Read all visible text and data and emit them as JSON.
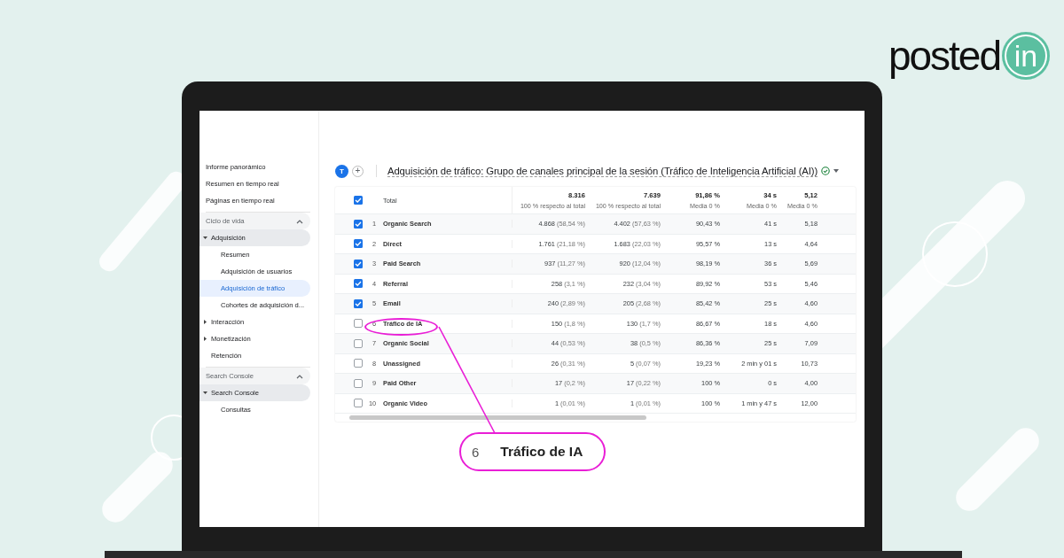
{
  "brand": {
    "logo_text": "posted",
    "logo_badge": "in"
  },
  "sidebar": {
    "top_items": [
      {
        "label": "Informe panorámico"
      },
      {
        "label": "Resumen en tiempo real"
      },
      {
        "label": "Páginas en tiempo real"
      }
    ],
    "sections": [
      {
        "title": "Ciclo de vida",
        "expanded": true,
        "items": [
          {
            "label": "Adquisición",
            "kind": "group",
            "expanded": true,
            "children": [
              {
                "label": "Resumen",
                "selected": false
              },
              {
                "label": "Adquisición de usuarios",
                "selected": false
              },
              {
                "label": "Adquisición de tráfico",
                "selected": true
              },
              {
                "label": "Cohortes de adquisición d...",
                "selected": false
              }
            ]
          },
          {
            "label": "Interacción",
            "kind": "group",
            "expanded": false
          },
          {
            "label": "Monetización",
            "kind": "group",
            "expanded": false
          },
          {
            "label": "Retención",
            "kind": "page"
          }
        ]
      },
      {
        "title": "Search Console",
        "expanded": true,
        "items": [
          {
            "label": "Search Console",
            "kind": "group",
            "expanded": true,
            "children": [
              {
                "label": "Consultas",
                "selected": false
              }
            ]
          }
        ]
      }
    ]
  },
  "report": {
    "avatar": "T",
    "add_button": "+",
    "title": "Adquisición de tráfico: Grupo de canales principal de la sesión (Tráfico de Inteligencia Artificial (AI))",
    "total": {
      "checked": true,
      "label": "Total",
      "values": [
        {
          "value": "8.316",
          "note": "100 % respecto al total"
        },
        {
          "value": "7.639",
          "note": "100 % respecto al total"
        },
        {
          "value": "91,86 %",
          "note": "Media 0 %"
        },
        {
          "value": "34 s",
          "note": "Media 0 %"
        },
        {
          "value": "5,12",
          "note": "Media 0 %"
        }
      ]
    },
    "rows": [
      {
        "index": "1",
        "checked": true,
        "highlighted": false,
        "channel": "Organic Search",
        "c1": "4.868",
        "c1_share": "(58,54 %)",
        "c2": "4.402",
        "c2_share": "(57,63 %)",
        "c3": "90,43 %",
        "c4": "41 s",
        "c5": "5,18"
      },
      {
        "index": "2",
        "checked": true,
        "highlighted": false,
        "channel": "Direct",
        "c1": "1.761",
        "c1_share": "(21,18 %)",
        "c2": "1.683",
        "c2_share": "(22,03 %)",
        "c3": "95,57 %",
        "c4": "13 s",
        "c5": "4,64"
      },
      {
        "index": "3",
        "checked": true,
        "highlighted": false,
        "channel": "Paid Search",
        "c1": "937",
        "c1_share": "(11,27 %)",
        "c2": "920",
        "c2_share": "(12,04 %)",
        "c3": "98,19 %",
        "c4": "36 s",
        "c5": "5,69"
      },
      {
        "index": "4",
        "checked": true,
        "highlighted": false,
        "channel": "Referral",
        "c1": "258",
        "c1_share": "(3,1 %)",
        "c2": "232",
        "c2_share": "(3,04 %)",
        "c3": "89,92 %",
        "c4": "53 s",
        "c5": "5,46"
      },
      {
        "index": "5",
        "checked": true,
        "highlighted": false,
        "channel": "Email",
        "c1": "240",
        "c1_share": "(2,89 %)",
        "c2": "205",
        "c2_share": "(2,68 %)",
        "c3": "85,42 %",
        "c4": "25 s",
        "c5": "4,60"
      },
      {
        "index": "6",
        "checked": false,
        "highlighted": true,
        "channel": "Tráfico de IA",
        "c1": "150",
        "c1_share": "(1,8 %)",
        "c2": "130",
        "c2_share": "(1,7 %)",
        "c3": "86,67 %",
        "c4": "18 s",
        "c5": "4,60"
      },
      {
        "index": "7",
        "checked": false,
        "highlighted": false,
        "channel": "Organic Social",
        "c1": "44",
        "c1_share": "(0,53 %)",
        "c2": "38",
        "c2_share": "(0,5 %)",
        "c3": "86,36 %",
        "c4": "25 s",
        "c5": "7,09"
      },
      {
        "index": "8",
        "checked": false,
        "highlighted": false,
        "channel": "Unassigned",
        "c1": "26",
        "c1_share": "(0,31 %)",
        "c2": "5",
        "c2_share": "(0,07 %)",
        "c3": "19,23 %",
        "c4": "2 min y 01 s",
        "c5": "10,73"
      },
      {
        "index": "9",
        "checked": false,
        "highlighted": false,
        "channel": "Paid Other",
        "c1": "17",
        "c1_share": "(0,2 %)",
        "c2": "17",
        "c2_share": "(0,22 %)",
        "c3": "100 %",
        "c4": "0 s",
        "c5": "4,00"
      },
      {
        "index": "10",
        "checked": false,
        "highlighted": false,
        "channel": "Organic Video",
        "c1": "1",
        "c1_share": "(0,01 %)",
        "c2": "1",
        "c2_share": "(0,01 %)",
        "c3": "100 %",
        "c4": "1 min y 47 s",
        "c5": "12,00"
      }
    ]
  },
  "callout": {
    "number": "6",
    "label": "Tráfico de IA"
  }
}
